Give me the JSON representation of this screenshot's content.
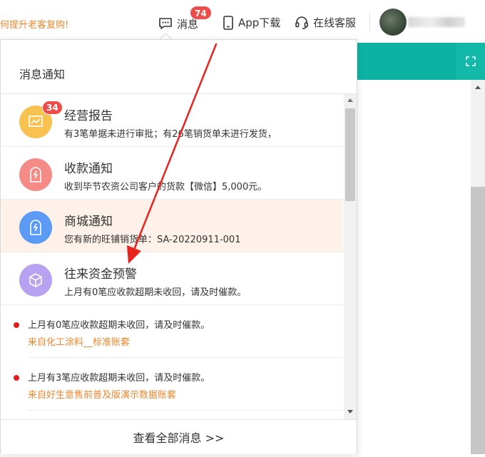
{
  "topbar": {
    "promo_text": "何提升老客复购!",
    "messages": {
      "label": "消息",
      "badge": "74"
    },
    "app_download": {
      "label": "App下载"
    },
    "online_service": {
      "label": "在线客服"
    }
  },
  "panel": {
    "title": "消息通知",
    "categories": [
      {
        "title": "经营报告",
        "desc": "有3笔单据未进行审批；有26笔销货单未进行发货，",
        "badge": "34",
        "icon": "chart-icon",
        "color": "#f7c24f"
      },
      {
        "title": "收款通知",
        "desc": "收到毕节农资公司客户的货款【微信】5,000元。",
        "icon": "payment-icon",
        "color": "#f48b86"
      },
      {
        "title": "商城通知",
        "desc": "您有新的旺铺销货单：SA-20220911-001",
        "icon": "store-icon",
        "color": "#5b9af5"
      },
      {
        "title": "往来资金预警",
        "desc": "上月有0笔应收款超期未收回，请及时催款。",
        "icon": "cube-icon",
        "color": "#b7a2f2"
      }
    ],
    "alerts": [
      {
        "text": "上月有0笔应收款超期未收回，请及时催款。",
        "source": "来自化工涂料__标准账套"
      },
      {
        "text": "上月有3笔应收款超期未收回，请及时催款。",
        "source": "来自好生意售前普及版演示数据账套"
      }
    ],
    "view_all": "查看全部消息 >>"
  },
  "colors": {
    "accent": "#0cb3a3",
    "badge": "#ee4b4b",
    "alert_source": "#f0862d",
    "annotation": "#e8231e"
  }
}
